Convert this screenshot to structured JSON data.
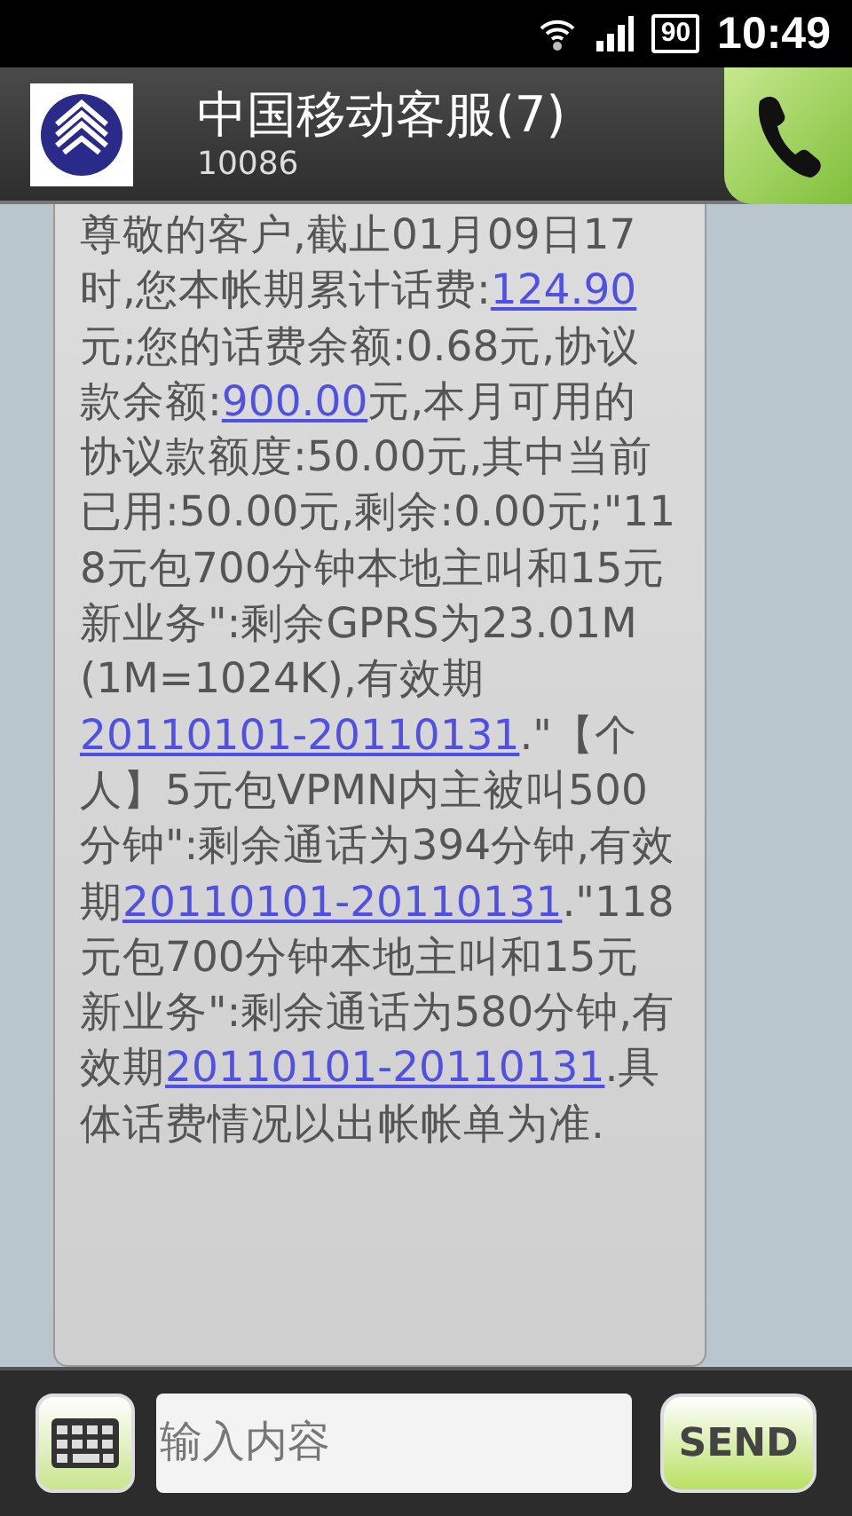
{
  "status_bar": {
    "battery": "90",
    "time": "10:49"
  },
  "header": {
    "title": "中国移动客服(7)",
    "number": "10086"
  },
  "message": [
    {
      "kind": "text",
      "text": "尊敬的客户,截止01月09日17时,您本帐期累计话费:"
    },
    {
      "kind": "link",
      "text": "124.90"
    },
    {
      "kind": "text",
      "text": "元;您的话费余额:0.68元,协议款余额:"
    },
    {
      "kind": "link",
      "text": "900.00"
    },
    {
      "kind": "text",
      "text": "元,本月可用的协议款额度:50.00元,其中当前已用:50.00元,剩余:0.00元;\"118元包700分钟本地主叫和15元新业务\":剩余GPRS为23.01M(1M=1024K),有效期"
    },
    {
      "kind": "link",
      "text": "20110101-20110131"
    },
    {
      "kind": "text",
      "text": ".\"【个人】5元包VPMN内主被叫500分钟\":剩余通话为394分钟,有效期"
    },
    {
      "kind": "link",
      "text": "20110101-20110131"
    },
    {
      "kind": "text",
      "text": ".\"118元包700分钟本地主叫和15元新业务\":剩余通话为580分钟,有效期"
    },
    {
      "kind": "link",
      "text": "20110101-20110131"
    },
    {
      "kind": "text",
      "text": ".具体话费情况以出帐帐单为准."
    }
  ],
  "composer": {
    "placeholder": "输入内容",
    "send": "SEND"
  }
}
